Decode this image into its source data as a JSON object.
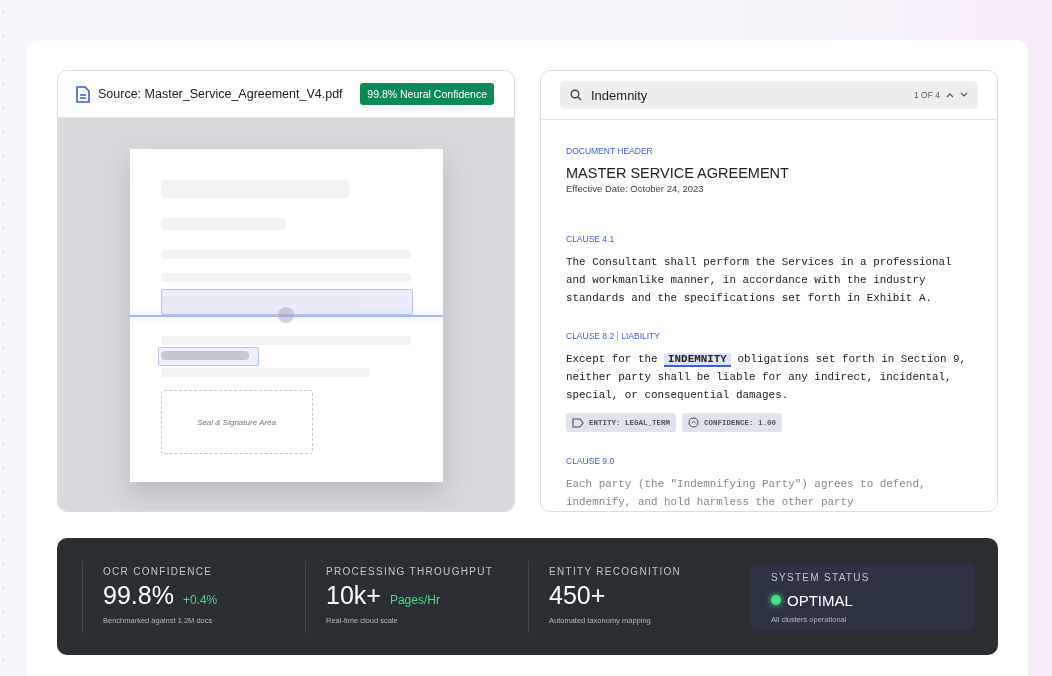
{
  "source": {
    "filename": "Source: Master_Service_Agreement_V4.pdf",
    "badge": "99.8% Neural Confidence",
    "seal_label": "Seal & Signature Area"
  },
  "search": {
    "value": "Indemnity",
    "count": "1 OF 4"
  },
  "document": {
    "section_label": "DOCUMENT HEADER",
    "title": "MASTER SERVICE AGREEMENT",
    "subtitle": "Effective Date: October 24, 2023",
    "clauses": [
      {
        "label": "CLAUSE 4.1",
        "text": "The Consultant shall perform the Services in a professional and workmanlike manner, in accordance with the industry standards and the specifications set forth in Exhibit A.",
        "faded": false
      },
      {
        "label": "CLAUSE 8.2",
        "tag": "LIABILITY",
        "text": "Except for the **INDEMNITY** obligations set forth in Section 9, neither party shall be liable for any indirect, incidental, special, or consequential damages.",
        "faded": false,
        "chips": [
          {
            "kind": "tag",
            "text": "ENTITY: LEGAL_TERM"
          },
          {
            "kind": "gauge",
            "text": "CONFIDENCE: 1.00"
          }
        ]
      },
      {
        "label": "CLAUSE 9.0",
        "text": "Each party (the \"Indemnifying Party\") agrees to defend, indemnify, and hold harmless the other party",
        "faded": true
      }
    ]
  },
  "stats": [
    {
      "kind": "metric",
      "label": "OCR CONFIDENCE",
      "value": "99.8%",
      "delta": "+0.4%",
      "note": "Benchmarked against 1.2M docs"
    },
    {
      "kind": "metric",
      "label": "PROCESSING THROUGHPUT",
      "value": "10k+",
      "delta": "Pages/Hr",
      "note": "Real-time cloud scale"
    },
    {
      "kind": "metric",
      "label": "ENTITY RECOGNITION",
      "value": "450+",
      "note": "Automated taxonomy mapping"
    },
    {
      "kind": "status",
      "label": "SYSTEM STATUS",
      "value": "OPTIMAL",
      "color": "#4ade80",
      "note": "All clusters operational"
    }
  ]
}
